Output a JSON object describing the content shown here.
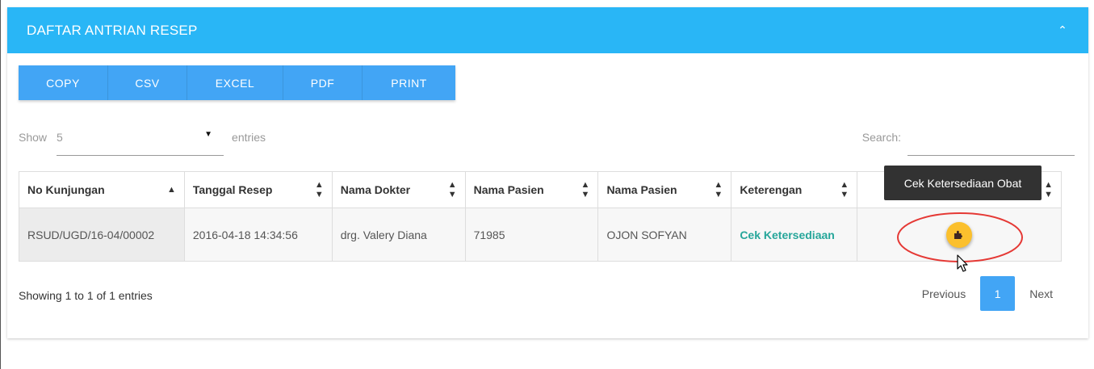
{
  "panel": {
    "title": "DAFTAR ANTRIAN RESEP",
    "collapse_icon": "chevron-up-icon"
  },
  "export_buttons": [
    {
      "label": "COPY"
    },
    {
      "label": "CSV"
    },
    {
      "label": "EXCEL"
    },
    {
      "label": "PDF"
    },
    {
      "label": "PRINT"
    }
  ],
  "length": {
    "show_label": "Show",
    "value": "5",
    "entries_label": "entries"
  },
  "search": {
    "label": "Search:",
    "value": ""
  },
  "table": {
    "columns": [
      {
        "label": "No Kunjungan"
      },
      {
        "label": "Tanggal Resep"
      },
      {
        "label": "Nama Dokter"
      },
      {
        "label": "Nama Pasien"
      },
      {
        "label": "Nama Pasien"
      },
      {
        "label": "Keterengan"
      },
      {
        "label": ""
      }
    ],
    "rows": [
      {
        "no_kunjungan": "RSUD/UGD/16-04/00002",
        "tanggal_resep": "2016-04-18 14:34:56",
        "nama_dokter": "drg. Valery Diana",
        "id_pasien": "71985",
        "nama_pasien": "OJON SOFYAN",
        "keterangan": "Cek Ketersediaan",
        "action_icon": "puzzle-icon"
      }
    ]
  },
  "tooltip": {
    "text": "Cek Ketersediaan Obat"
  },
  "info": {
    "text": "Showing 1 to 1 of 1 entries"
  },
  "pagination": {
    "previous": "Previous",
    "current": "1",
    "next": "Next"
  },
  "colors": {
    "header": "#29b6f6",
    "button": "#42a5f5",
    "fab": "#fbc02d",
    "status_link": "#26a69a",
    "highlight": "#e53935",
    "tooltip_bg": "#323232"
  }
}
